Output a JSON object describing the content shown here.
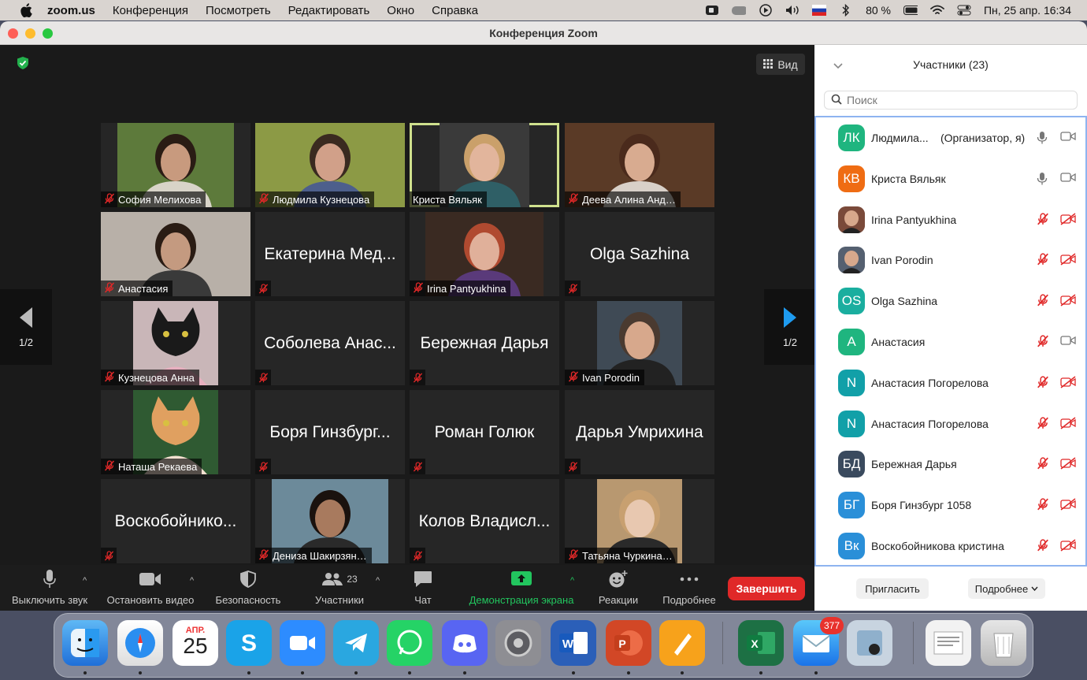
{
  "menubar": {
    "app": "zoom.us",
    "items": [
      "Конференция",
      "Посмотреть",
      "Редактировать",
      "Окно",
      "Справка"
    ],
    "battery": "80 %",
    "datetime": "Пн, 25 апр.  16:34"
  },
  "window": {
    "title": "Конференция Zoom"
  },
  "video": {
    "view_label": "Вид",
    "prev_page": "1/2",
    "next_page": "1/2",
    "tiles": [
      {
        "name": "София Мелихова",
        "video": true
      },
      {
        "name": "Людмила Кузнецова",
        "video": true
      },
      {
        "name": "Криста Вяльяк",
        "video": true,
        "active": true
      },
      {
        "name": "Деева Алина Анд…",
        "video": true
      },
      {
        "name": "Анастасия",
        "video": true
      },
      {
        "name": "Екатерина Мед...",
        "video": false
      },
      {
        "name": "Irina Pantyukhina",
        "video": true
      },
      {
        "name": "Olga Sazhina",
        "video": false
      },
      {
        "name": "Кузнецова Анна",
        "video": true
      },
      {
        "name": "Соболева Анас...",
        "video": false
      },
      {
        "name": "Бережная Дарья",
        "video": false
      },
      {
        "name": "Ivan Porodin",
        "video": true
      },
      {
        "name": "Наташа Рекаева",
        "video": true
      },
      {
        "name": "Боря Гинзбург...",
        "video": false
      },
      {
        "name": "Роман Голюк",
        "video": false
      },
      {
        "name": "Дарья Умрихина",
        "video": false
      },
      {
        "name": "Воскобойнико...",
        "video": false
      },
      {
        "name": "Дениза Шакирзян…",
        "video": true
      },
      {
        "name": "Колов Владисл...",
        "video": false
      },
      {
        "name": "Татьяна Чуркина…",
        "video": true
      }
    ]
  },
  "toolbar": {
    "mute": "Выключить звук",
    "video": "Остановить видео",
    "security": "Безопасность",
    "participants": "Участники",
    "participants_count": "23",
    "chat": "Чат",
    "share": "Демонстрация экрана",
    "reactions": "Реакции",
    "more": "Подробнее",
    "end": "Завершить"
  },
  "panel": {
    "title": "Участники (23)",
    "search_placeholder": "Поиск",
    "participants": [
      {
        "initials": "ЛК",
        "name": "Людмила...",
        "role": "(Организатор, я)",
        "color": "#1fb57f",
        "mic": "on",
        "cam": "on"
      },
      {
        "initials": "КВ",
        "name": "Криста Вяльяк",
        "color": "#ef6c13",
        "mic": "on",
        "cam": "on"
      },
      {
        "initials": "",
        "name": "Irina Pantyukhina",
        "color": "#7a4a3a",
        "photo": true,
        "mic": "off",
        "cam": "off"
      },
      {
        "initials": "",
        "name": "Ivan Porodin",
        "color": "#556070",
        "photo": true,
        "mic": "off",
        "cam": "off"
      },
      {
        "initials": "OS",
        "name": "Olga Sazhina",
        "color": "#1aae9f",
        "mic": "off",
        "cam": "off"
      },
      {
        "initials": "А",
        "name": "Анастасия",
        "color": "#1fb57f",
        "mic": "off",
        "cam": "on"
      },
      {
        "initials": "N",
        "name": "Анастасия Погорелова",
        "color": "#12a0a8",
        "mic": "off",
        "cam": "off"
      },
      {
        "initials": "N",
        "name": "Анастасия Погорелова",
        "color": "#12a0a8",
        "mic": "off",
        "cam": "off"
      },
      {
        "initials": "БД",
        "name": "Бережная Дарья",
        "color": "#3a4a5e",
        "mic": "off",
        "cam": "off"
      },
      {
        "initials": "БГ",
        "name": "Боря Гинзбург 1058",
        "color": "#2a8fd8",
        "mic": "off",
        "cam": "off"
      },
      {
        "initials": "Вк",
        "name": "Воскобойникова кристина",
        "color": "#2a8fd8",
        "mic": "off",
        "cam": "off"
      }
    ],
    "invite": "Пригласить",
    "more": "Подробнее"
  },
  "dock": {
    "apps": [
      "finder-icon",
      "safari-icon",
      "calendar-icon",
      "skype-icon",
      "zoom-icon",
      "telegram-icon",
      "whatsapp-icon",
      "discord-icon",
      "system-preferences-icon",
      "word-icon",
      "powerpoint-icon",
      "pages-icon",
      "excel-icon",
      "mail-icon",
      "preview-icon",
      "documents-icon",
      "trash-icon"
    ],
    "calendar_month": "АПР.",
    "calendar_day": "25",
    "mail_badge": "377"
  },
  "colors": {
    "active_speaker": "#cfe08d",
    "mute_red": "#e02828",
    "share_green": "#22c55e",
    "panel_border": "#8eb4f0"
  }
}
